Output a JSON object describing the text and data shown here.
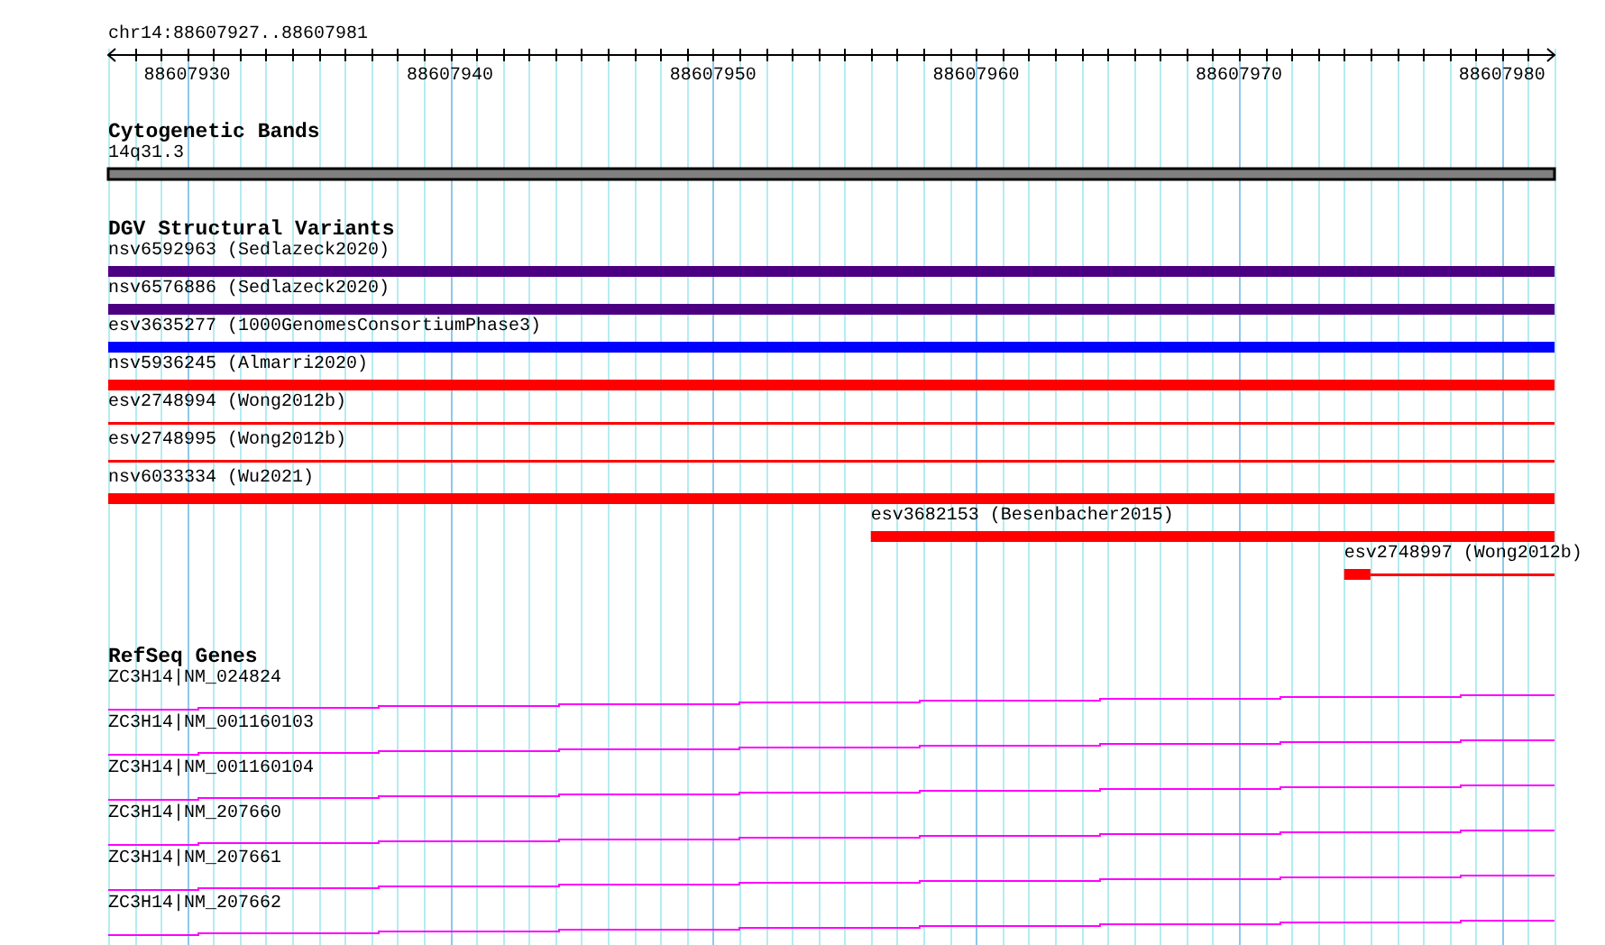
{
  "ruler": {
    "location": "chr14:88607927..88607981",
    "ticks": [
      "88607930",
      "88607940",
      "88607950",
      "88607960",
      "88607970",
      "88607980"
    ]
  },
  "cytogenetic_bands": {
    "title": "Cytogenetic Bands",
    "bands": [
      {
        "name": "14q31.3"
      }
    ]
  },
  "dgv_structural_variants": {
    "title": "DGV Structural Variants",
    "variants": [
      {
        "label": "nsv6592963 (Sedlazeck2020)",
        "color": "#4b0082",
        "parts": [
          {
            "kind": "thick"
          }
        ]
      },
      {
        "label": "nsv6576886 (Sedlazeck2020)",
        "color": "#4b0082",
        "parts": [
          {
            "kind": "thick"
          }
        ]
      },
      {
        "label": "esv3635277 (1000GenomesConsortiumPhase3)",
        "color": "#0000ff",
        "parts": [
          {
            "kind": "thick"
          }
        ]
      },
      {
        "label": "nsv5936245 (Almarri2020)",
        "color": "#ff0000",
        "parts": [
          {
            "kind": "thick"
          }
        ]
      },
      {
        "label": "esv2748994 (Wong2012b)",
        "color": "#ff0000",
        "parts": [
          {
            "kind": "thin"
          }
        ]
      },
      {
        "label": "esv2748995 (Wong2012b)",
        "color": "#ff0000",
        "parts": [
          {
            "kind": "thin"
          }
        ]
      },
      {
        "label": "nsv6033334 (Wu2021)",
        "color": "#ff0000",
        "parts": [
          {
            "kind": "thick"
          }
        ]
      },
      {
        "label": "esv3682153 (Besenbacher2015)",
        "color": "#ff0000",
        "parts": [
          {
            "kind": "thick"
          }
        ]
      },
      {
        "label": "esv2748997 (Wong2012b)",
        "color": "#ff0000",
        "parts": [
          {
            "kind": "thick"
          },
          {
            "kind": "thin"
          }
        ]
      }
    ]
  },
  "refseq_genes": {
    "title": "RefSeq Genes",
    "transcripts": [
      {
        "label": "ZC3H14|NM_024824"
      },
      {
        "label": "ZC3H14|NM_001160103"
      },
      {
        "label": "ZC3H14|NM_001160104"
      },
      {
        "label": "ZC3H14|NM_207660"
      },
      {
        "label": "ZC3H14|NM_207661"
      },
      {
        "label": "ZC3H14|NM_207662"
      }
    ]
  }
}
